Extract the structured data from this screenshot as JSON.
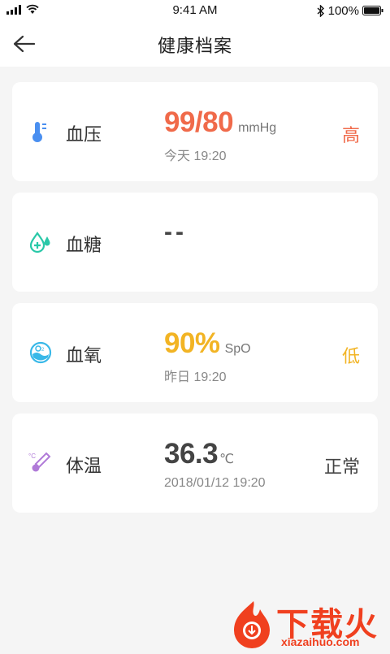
{
  "status_bar": {
    "time": "9:41 AM",
    "battery": "100%"
  },
  "nav": {
    "title": "健康档案",
    "back_icon": "back-arrow-icon"
  },
  "colors": {
    "high": "#f06a4a",
    "low": "#f2b424",
    "normal": "#444444",
    "pressure_icon": "#4a8ff0",
    "sugar_icon": "#29c8a8",
    "oxygen_icon": "#38b8e8",
    "temp_icon": "#b07ad8"
  },
  "cards": [
    {
      "label": "血压",
      "icon": "thermometer-icon",
      "value": "99/80",
      "unit": "mmHg",
      "time": "今天 19:20",
      "status": "高"
    },
    {
      "label": "血糖",
      "icon": "water-drop-icon",
      "value": "--"
    },
    {
      "label": "血氧",
      "icon": "oxygen-icon",
      "value": "90%",
      "unit": "SpO",
      "time": "昨日 19:20",
      "status": "低"
    },
    {
      "label": "体温",
      "icon": "temperature-icon",
      "value": "36.3",
      "unit": "℃",
      "time": "2018/01/12 19:20",
      "status": "正常"
    }
  ],
  "watermark": {
    "text": "下载火",
    "url": "xiazaihuo.com"
  }
}
